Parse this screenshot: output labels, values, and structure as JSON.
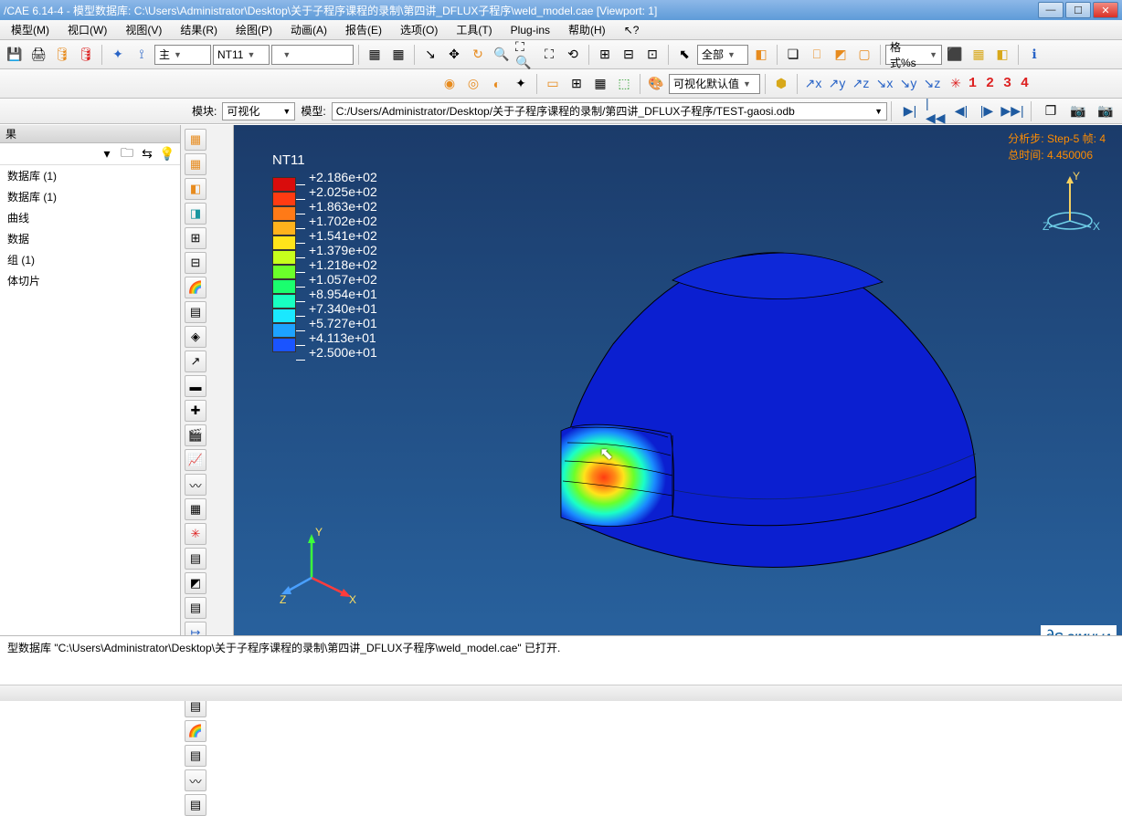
{
  "window": {
    "title": "/CAE 6.14-4 - 模型数据库: C:\\Users\\Administrator\\Desktop\\关于子程序课程的录制\\第四讲_DFLUX子程序\\weld_model.cae [Viewport: 1]",
    "minimize": "—",
    "maximize": "☐",
    "close": "✕"
  },
  "menu": [
    "模型(M)",
    "视口(W)",
    "视图(V)",
    "结果(R)",
    "绘图(P)",
    "动画(A)",
    "报告(E)",
    "选项(O)",
    "工具(T)",
    "Plug-ins",
    "帮助(H)",
    "↖?"
  ],
  "toolbar1": {
    "combo_main_label": "主",
    "combo_var": "NT11",
    "all_label": "全部",
    "format_label": "格式%s"
  },
  "toolbar2": {
    "vis_default": "可视化默认值"
  },
  "contextbar": {
    "module_label": "模块:",
    "module_value": "可视化",
    "model_label": "模型:",
    "model_path": "C:/Users/Administrator/Desktop/关于子程序课程的录制/第四讲_DFLUX子程序/TEST-gaosi.odb"
  },
  "tree": {
    "header": "果",
    "items": [
      "数据库 (1)",
      "数据库 (1)",
      "曲线",
      "数据",
      "组 (1)",
      "体切片"
    ]
  },
  "viewport": {
    "step_line": "分析步: Step-5    帧: 4",
    "time_line": "总时间: 4.450006",
    "legend_title": "NT11",
    "legend": [
      {
        "val": "+2.186e+02",
        "color": "#d90c0c"
      },
      {
        "val": "+2.025e+02",
        "color": "#ff3b12"
      },
      {
        "val": "+1.863e+02",
        "color": "#ff7a17"
      },
      {
        "val": "+1.702e+02",
        "color": "#ffb21c"
      },
      {
        "val": "+1.541e+02",
        "color": "#ffe41a"
      },
      {
        "val": "+1.379e+02",
        "color": "#c7ff1c"
      },
      {
        "val": "+1.218e+02",
        "color": "#6bff2a"
      },
      {
        "val": "+1.057e+02",
        "color": "#1aff6e"
      },
      {
        "val": "+8.954e+01",
        "color": "#18ffc1"
      },
      {
        "val": "+7.340e+01",
        "color": "#1ae8ff"
      },
      {
        "val": "+5.727e+01",
        "color": "#1da2ff"
      },
      {
        "val": "+4.113e+01",
        "color": "#1a54ff"
      },
      {
        "val": "+2.500e+01",
        "color": "#0b1bd0"
      }
    ],
    "triad": {
      "x": "X",
      "y": "Y",
      "z": "Z"
    },
    "compass": {
      "x": "X",
      "y": "Y",
      "z": "Z"
    }
  },
  "message": "型数据库  \"C:\\Users\\Administrator\\Desktop\\关于子程序课程的录制\\第四讲_DFLUX子程序\\weld_model.cae\"  已打开.",
  "brand": "SIMULIA",
  "axis_numbers": [
    "1",
    "2",
    "3",
    "4"
  ]
}
